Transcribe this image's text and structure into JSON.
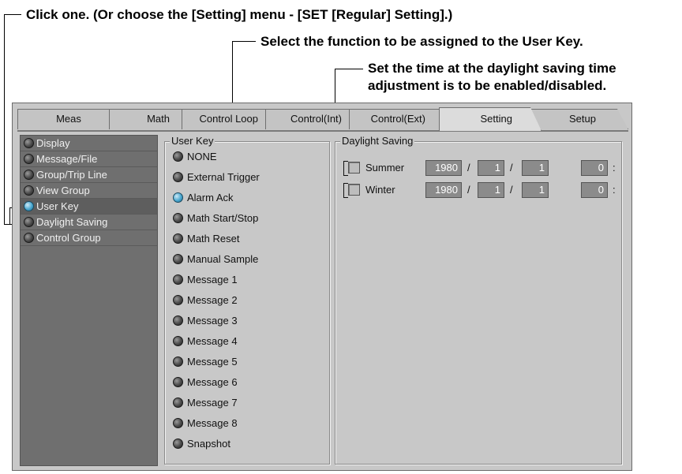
{
  "callouts": {
    "top": "Click one. (Or choose the [Setting] menu - [SET [Regular] Setting].)",
    "user_key": "Select the function to be assigned to the User Key.",
    "daylight_line1": "Set the time at the daylight saving time",
    "daylight_line2": "adjustment is to be enabled/disabled."
  },
  "tabs": [
    {
      "label": "Meas"
    },
    {
      "label": "Math"
    },
    {
      "label": "Control Loop"
    },
    {
      "label": "Control(Int)"
    },
    {
      "label": "Control(Ext)"
    },
    {
      "label": "Setting",
      "active": true
    },
    {
      "label": "Setup"
    }
  ],
  "sidebar": {
    "items": [
      {
        "label": "Display"
      },
      {
        "label": "Message/File"
      },
      {
        "label": "Group/Trip Line"
      },
      {
        "label": "View Group"
      },
      {
        "label": "User Key",
        "selected": true
      },
      {
        "label": "Daylight Saving"
      },
      {
        "label": "Control Group"
      }
    ]
  },
  "user_key": {
    "title": "User Key",
    "selected": "Alarm Ack",
    "options": [
      "NONE",
      "External Trigger",
      "Alarm Ack",
      "Math Start/Stop",
      "Math Reset",
      "Manual Sample",
      "Message 1",
      "Message 2",
      "Message 3",
      "Message 4",
      "Message 5",
      "Message 6",
      "Message 7",
      "Message 8",
      "Snapshot"
    ]
  },
  "daylight_saving": {
    "title": "Daylight Saving",
    "rows": [
      {
        "label": "Summer",
        "year": "1980",
        "month": "1",
        "day": "1",
        "hour": "0",
        "checked": false
      },
      {
        "label": "Winter",
        "year": "1980",
        "month": "1",
        "day": "1",
        "hour": "0",
        "checked": false
      }
    ],
    "date_sep": "/",
    "time_sep": ":"
  },
  "colors": {
    "panel": "#c8c8c8",
    "sidebar": "#6f6f6f",
    "field": "#8b8b8b",
    "led_on": "#4aa8d0"
  },
  "icons": {
    "radio_off": "grey-led-icon",
    "radio_on": "blue-led-icon"
  }
}
